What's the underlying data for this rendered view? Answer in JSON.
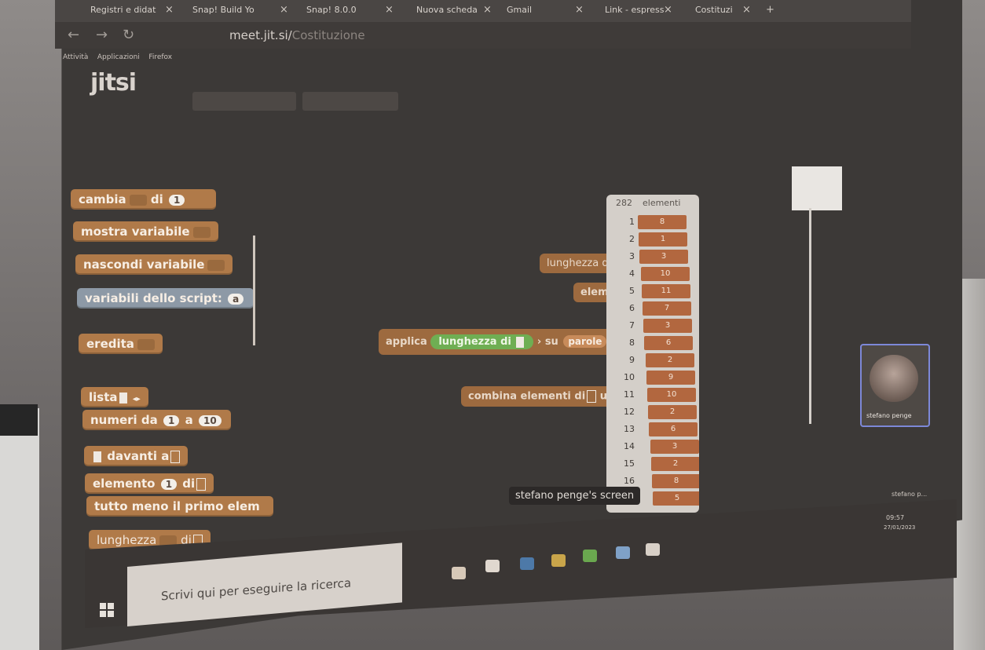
{
  "browser": {
    "tabs": [
      "Registri e didat",
      "Snap! Build Yo",
      "Snap! 8.0.0",
      "Nuova scheda",
      "Gmail",
      "Link - espress",
      "Costituzi"
    ],
    "url_host": "meet.jit.si/",
    "url_path": "Costituzione",
    "menu": [
      "Attività",
      "Applicazioni",
      "Firefox"
    ],
    "logo": "jitsi"
  },
  "palette": {
    "cambia": {
      "label": "cambia",
      "di": "di",
      "value": "1"
    },
    "mostra": "mostra variabile",
    "nascondi": "nascondi variabile",
    "variabili": "variabili dello script:",
    "variabili_slot": "a",
    "eredita": "eredita",
    "lista": "lista",
    "numeri": {
      "label": "numeri da",
      "from": "1",
      "a": "a",
      "to": "10"
    },
    "davanti": "davanti a",
    "elemento": {
      "label": "elemento",
      "value": "1",
      "di": "di"
    },
    "tutto_meno": "tutto meno il primo elem",
    "lunghezza": {
      "label": "lunghezza",
      "di": "di"
    }
  },
  "script": {
    "lunghezza_top": "lunghezza",
    "lunghezza_top_suffix": "d",
    "elemen": "elemen",
    "applica": "applica",
    "lunghezza_di": "lunghezza di",
    "su": "su",
    "parole": "parole",
    "combina": "combina elementi di",
    "usan": "usan"
  },
  "watcher": {
    "count": "282",
    "title": "elementi",
    "rows": [
      {
        "i": "1",
        "v": "8"
      },
      {
        "i": "2",
        "v": "1"
      },
      {
        "i": "3",
        "v": "3"
      },
      {
        "i": "4",
        "v": "10"
      },
      {
        "i": "5",
        "v": "11"
      },
      {
        "i": "6",
        "v": "7"
      },
      {
        "i": "7",
        "v": "3"
      },
      {
        "i": "8",
        "v": "6"
      },
      {
        "i": "9",
        "v": "2"
      },
      {
        "i": "10",
        "v": "9"
      },
      {
        "i": "11",
        "v": "10"
      },
      {
        "i": "12",
        "v": "2"
      },
      {
        "i": "13",
        "v": "6"
      },
      {
        "i": "14",
        "v": "3"
      },
      {
        "i": "15",
        "v": "2"
      },
      {
        "i": "16",
        "v": "8"
      },
      {
        "i": "17",
        "v": "5"
      }
    ]
  },
  "screen_caption": "stefano penge's screen",
  "video_name": "stefano penge",
  "video_side_label": "stefano p...",
  "taskbar": {
    "search_placeholder": "Scrivi qui per eseguire la ricerca",
    "time": "09:57",
    "date": "27/01/2023"
  }
}
